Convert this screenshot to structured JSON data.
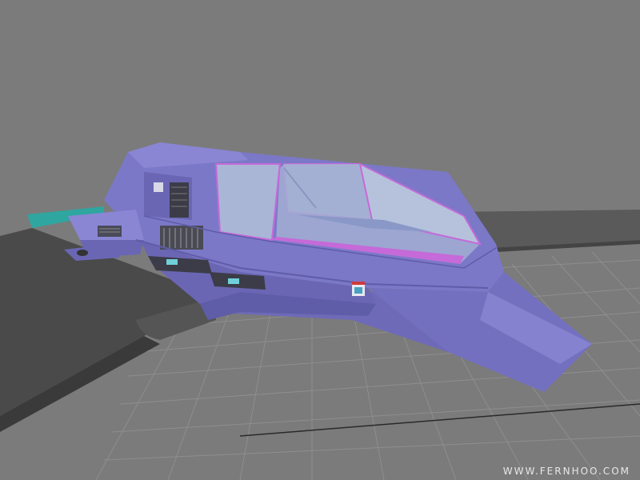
{
  "scene": {
    "subject": "hovercraft-3d-model",
    "colors": {
      "background": "#7b7b7b",
      "grid": "#8e8e8e",
      "grid_axis": "#2a2a2a",
      "hull": "#7b78c8",
      "hull_dark": "#5f5ca8",
      "hull_light": "#9a96e0",
      "glass": "#a9b6d6",
      "canopy_trim": "#c56ad8",
      "wing": "#4a4a4a",
      "wing_top": "#5a5a5a",
      "teal_strip": "#2fa6a0"
    }
  },
  "watermark": {
    "text": "WWW.FERNHOO.COM"
  }
}
